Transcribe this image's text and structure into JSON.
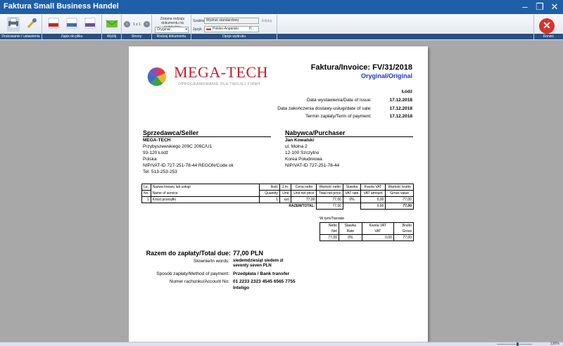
{
  "window": {
    "title": "Faktura Small Business Handel"
  },
  "toolbar": {
    "groups": {
      "print_settings": "Drukowanie / ustawienia",
      "save_file": "Zapis do pliku",
      "send": "Wyślij",
      "pages": "Strony",
      "doc_type": "Rodzaj dokumentu",
      "print_options": "Opcje wydruku",
      "exit": "Koniec"
    },
    "pages": {
      "counter": "1 z 1"
    },
    "doc_type": {
      "label": "Zmiana rodzaju dokumentu na podglądzie",
      "value": "Oryginał"
    },
    "print_options": {
      "template_label": "Szablon",
      "template_value": "Wydruk standardowy",
      "edit_label": "Edytuj",
      "language_label": "Język",
      "language_value": "Polsko-Angielski",
      "language_extra": "P..."
    },
    "file_formats": [
      "PDF",
      "HTML",
      "JPG"
    ]
  },
  "exit": {
    "label": "Koniec"
  },
  "invoice": {
    "brand": "MEGA-TECH",
    "tagline": "OPROGRAMOWANIE DLA TWOJEJ FIRMY",
    "title": "Faktura/Invoice: FV/31/2018",
    "copy": "Oryginał/Original",
    "place": "Łódź",
    "issue_label": "Data wystawienia/Date of issue:",
    "issue_date": "17.12.2018",
    "sale_label": "Data zakończenia dostawy-usługi/date of sale:",
    "sale_date": "17.12.2018",
    "payment_label": "Termin zapłaty/Term of payment:",
    "payment_date": "17.12.2018",
    "seller": {
      "heading": "Sprzedawca/Seller",
      "name": "MEGA-TECH",
      "l1": "Przybyszewskiego 209C 209C/U1",
      "l2": "93-120 Łódź",
      "l3": "Polska",
      "l4": "NIP/VAT-ID 727-251-78-44   REGON/Code ok",
      "l5": "Tel: 513-253-253"
    },
    "buyer": {
      "heading": "Nabywca/Purchaser",
      "name": "Jan Kowalski",
      "l1": "ul. Molna 2",
      "l2": "12-100 Szczytno",
      "l3": "Korea Południowa",
      "l4": "NIP/VAT-ID 727-251-78-44"
    },
    "items_header": {
      "lp": "Lp.",
      "no": "No",
      "name_pl": "Nazwa towaru lub usługi",
      "name_en": "Name of service",
      "qty_pl": "Ilość",
      "qty_en": "Quantity",
      "unit_pl": "J.m.",
      "unit_en": "Unit",
      "net_price_pl": "Cena netto",
      "net_price_en": "Unit net price",
      "net_val_pl": "Wartość netto",
      "net_val_en": "Total net price",
      "rate_pl": "Stawka",
      "rate_en": "VAT rate",
      "vat_pl": "Kwota VAT",
      "vat_en": "VAT amount",
      "gross_pl": "Wartość brutto",
      "gross_en": "Gross value"
    },
    "items": [
      {
        "lp": "1",
        "name": "Koszt przesyłki",
        "qty": "1",
        "unit": "szt.",
        "net_price": "77,00",
        "net_value": "77,00",
        "rate": "0%",
        "vat": "0,00",
        "gross": "77,00"
      }
    ],
    "totals": {
      "label": "RAZEM/TOTAL:",
      "net": "77,00",
      "vat": "0,00",
      "gross": "77,00"
    },
    "summary": {
      "label": "W tym/Taxrate",
      "h_net_pl": "Netto",
      "h_net_en": "Net",
      "h_rate_pl": "Stawka",
      "h_rate_en": "Rate",
      "h_vat_pl": "Kwota VAT",
      "h_vat_en": "VAT",
      "h_gross_pl": "Brutto",
      "h_gross_en": "Gross",
      "net": "77,00",
      "rate": "0%",
      "vat": "0,00",
      "gross": "77,00"
    },
    "total_due_label": "Razem do zapłaty/Total due:",
    "total_due": "77,00 PLN",
    "words_label": "Słownie/In words:",
    "words_l1": "siedemdziesiąt siedem zł",
    "words_l2": "seventy seven PLN",
    "method_label": "Sposób zapłaty/Method of payment:",
    "method": "Przedpłata / Bank transfer",
    "account_label": "Numer rachunku/Account No:",
    "account": "01 2233 2323 4545 6565 7755",
    "bank": "Inteligo"
  },
  "status": {
    "zoom": "130%"
  }
}
